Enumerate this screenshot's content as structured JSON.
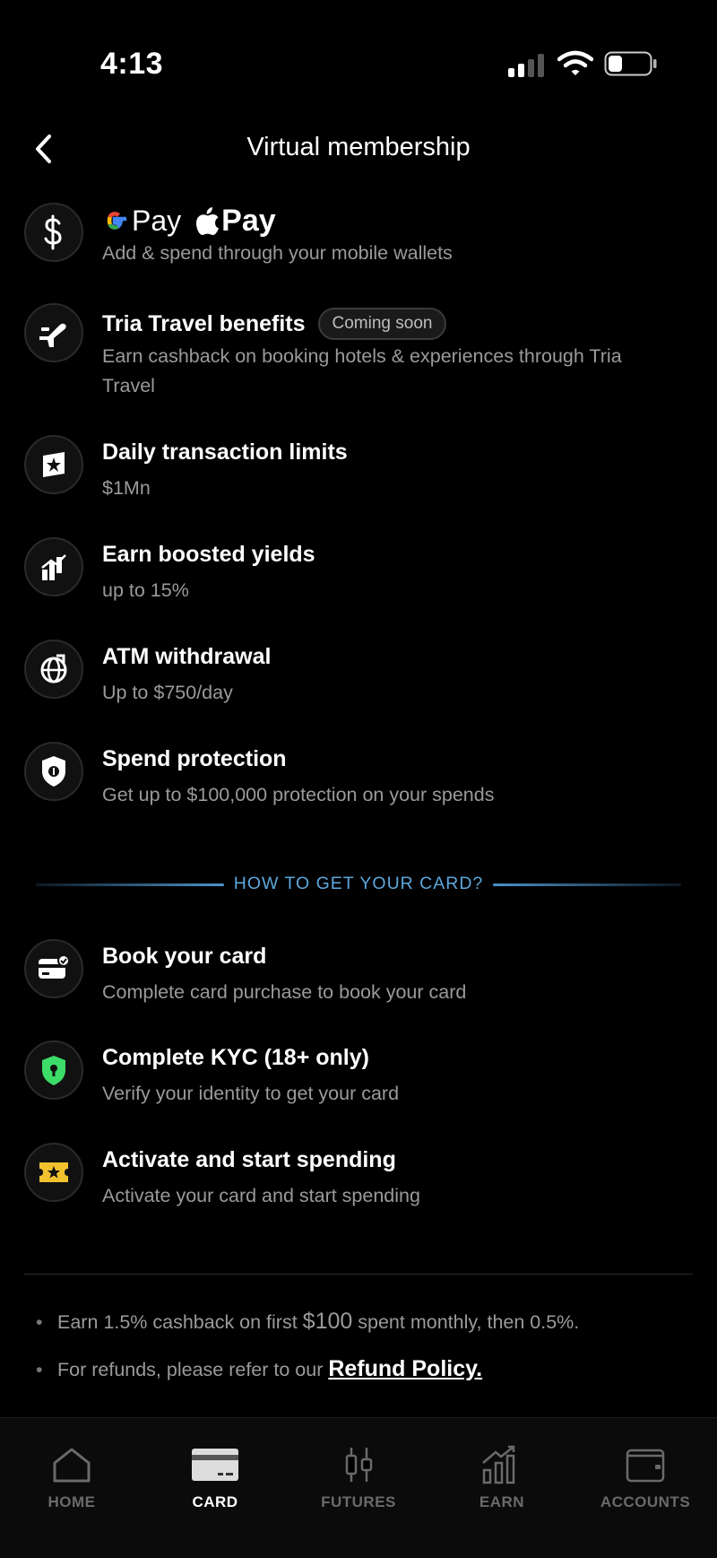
{
  "status_bar": {
    "time": "4:13"
  },
  "header": {
    "title": "Virtual membership"
  },
  "wallets": {
    "gpay_label": "Pay",
    "apay_label": "Pay",
    "desc": "Add & spend through your mobile wallets"
  },
  "features": [
    {
      "icon": "travel-plane-icon",
      "title": "Tria Travel benefits",
      "badge": "Coming soon",
      "desc": "Earn cashback on booking hotels & experiences through Tria Travel"
    },
    {
      "icon": "limit-icon",
      "title": "Daily transaction limits",
      "desc": "$1Mn"
    },
    {
      "icon": "yield-chart-icon",
      "title": "Earn boosted yields",
      "desc": "up to 15%"
    },
    {
      "icon": "atm-globe-icon",
      "title": "ATM withdrawal",
      "desc": "Up to $750/day"
    },
    {
      "icon": "shield-protection-icon",
      "title": "Spend protection",
      "desc": "Get up to $100,000 protection on your spends"
    }
  ],
  "how_to": {
    "heading": "HOW TO GET YOUR CARD?"
  },
  "steps": [
    {
      "icon": "card-check-icon",
      "title": "Book your card",
      "desc": "Complete card purchase to book your card",
      "color": "#ffffff"
    },
    {
      "icon": "shield-lock-icon",
      "title": "Complete KYC (18+ only)",
      "desc": "Verify your identity to get your card",
      "color": "#3ddc68"
    },
    {
      "icon": "ticket-star-icon",
      "title": "Activate and start spending",
      "desc": "Activate your card and start spending",
      "color": "#f2c12e"
    }
  ],
  "notes": {
    "cashback_pre": "Earn 1.5% cashback on first ",
    "cashback_amount": "$100",
    "cashback_post": " spent monthly, then 0.5%.",
    "refund_pre": "For refunds, please refer to our ",
    "refund_link": "Refund Policy."
  },
  "nav": [
    {
      "label": "HOME",
      "icon": "home-icon",
      "active": false
    },
    {
      "label": "CARD",
      "icon": "card-icon",
      "active": true
    },
    {
      "label": "FUTURES",
      "icon": "futures-candles-icon",
      "active": false
    },
    {
      "label": "EARN",
      "icon": "earn-chart-icon",
      "active": false
    },
    {
      "label": "ACCOUNTS",
      "icon": "wallet-icon",
      "active": false
    }
  ]
}
